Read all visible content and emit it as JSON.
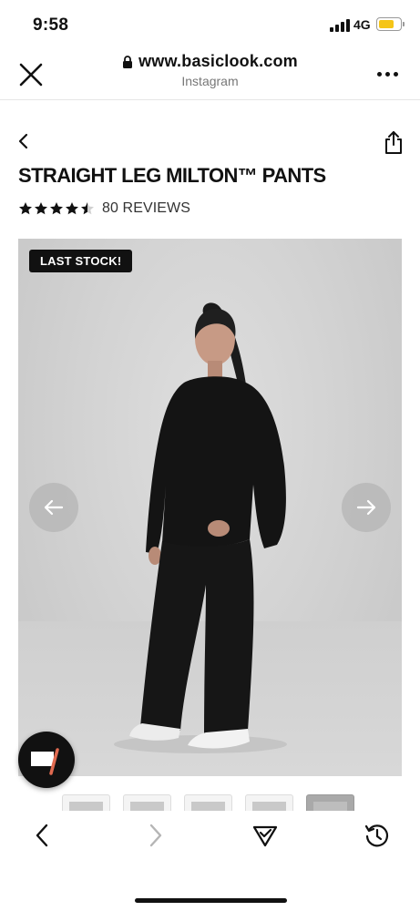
{
  "status_bar": {
    "time": "9:58",
    "network": "4G",
    "battery_level": 0.75,
    "battery_color": "#f5c518"
  },
  "browser": {
    "url": "www.basiclook.com",
    "source": "Instagram",
    "close_icon": "close-icon",
    "more_icon": "more-horizontal-icon"
  },
  "product": {
    "title": "STRAIGHT LEG MILTON™ PANTS",
    "rating": 4.5,
    "rating_max": 5,
    "reviews_label": "80 REVIEWS",
    "badge": "LAST STOCK!"
  },
  "gallery": {
    "thumbnail_count": 5,
    "active_index": 4
  },
  "toolbar": {
    "back_icon": "chevron-left-icon",
    "forward_icon": "chevron-right-icon",
    "tracker_icon": "shield-check-icon",
    "history_icon": "history-icon"
  },
  "colors": {
    "text": "#111111",
    "badge_bg": "#111111",
    "image_bg": "#d3d3d3"
  }
}
